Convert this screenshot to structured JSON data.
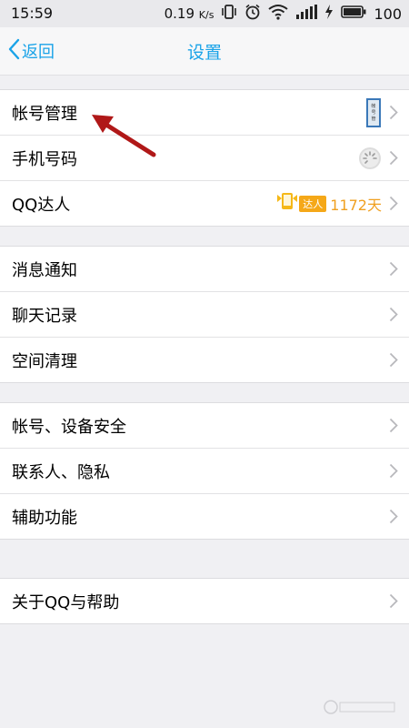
{
  "status_bar": {
    "time": "15:59",
    "speed": "0.19",
    "speed_unit": "K/s",
    "battery": "100"
  },
  "nav": {
    "back_label": "返回",
    "title": "设置"
  },
  "groups": [
    {
      "items": [
        {
          "label": "帐号管理",
          "extra": "account-thumbnail"
        },
        {
          "label": "手机号码",
          "extra": "loading-spinner"
        },
        {
          "label": "QQ达人",
          "extra": "qq-expert-badge",
          "badge_text": "达人",
          "days": "1172天"
        }
      ]
    },
    {
      "items": [
        {
          "label": "消息通知"
        },
        {
          "label": "聊天记录"
        },
        {
          "label": "空间清理"
        }
      ]
    },
    {
      "items": [
        {
          "label": "帐号、设备安全"
        },
        {
          "label": "联系人、隐私"
        },
        {
          "label": "辅助功能"
        }
      ]
    },
    {
      "items": [
        {
          "label": "关于QQ与帮助"
        }
      ]
    }
  ],
  "colors": {
    "accent": "#1aa3e8",
    "days": "#f0a020",
    "annotation": "#b01818"
  }
}
